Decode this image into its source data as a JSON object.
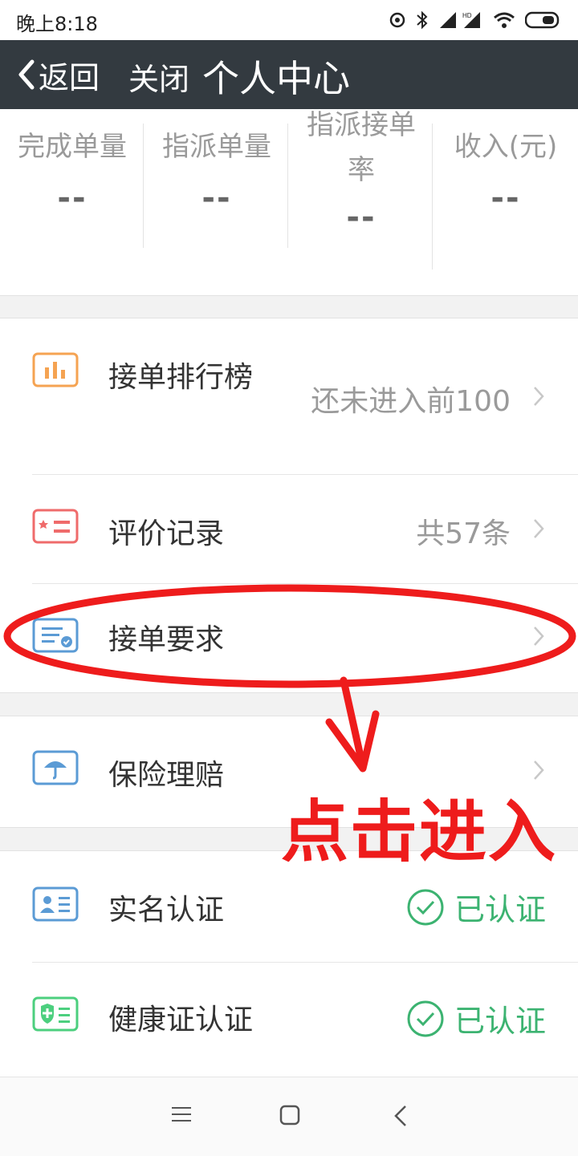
{
  "status_bar": {
    "time": "晚上8:18",
    "battery_icon": "battery-icon",
    "wifi_icon": "wifi-icon",
    "signal_icon": "signal-icon"
  },
  "header": {
    "back_label": "返回",
    "close_label": "关闭",
    "title": "个人中心",
    "bg": "#333a40"
  },
  "stats": [
    {
      "label": "完成单量",
      "value": "--"
    },
    {
      "label": "指派单量",
      "value": "--"
    },
    {
      "label": "指派接单率",
      "value": "--"
    },
    {
      "label": "收入(元)",
      "value": "--"
    }
  ],
  "menu": {
    "ranking": {
      "label": "接单排行榜",
      "value": "还未进入前100"
    },
    "reviews": {
      "label": "评价记录",
      "value": "共57条"
    },
    "requirements": {
      "label": "接单要求"
    },
    "insurance": {
      "label": "保险理赔"
    },
    "realname": {
      "label": "实名认证",
      "status": "已认证"
    },
    "health": {
      "label": "健康证认证",
      "status": "已认证"
    }
  },
  "annotation": {
    "text": "点击进入",
    "color": "#ee1c1c"
  },
  "colors": {
    "verified": "#3cb371",
    "orange_icon": "#f5a352",
    "red_icon": "#ef6b6b",
    "blue_icon": "#5b9bd5",
    "green_icon": "#4ccf7e"
  }
}
